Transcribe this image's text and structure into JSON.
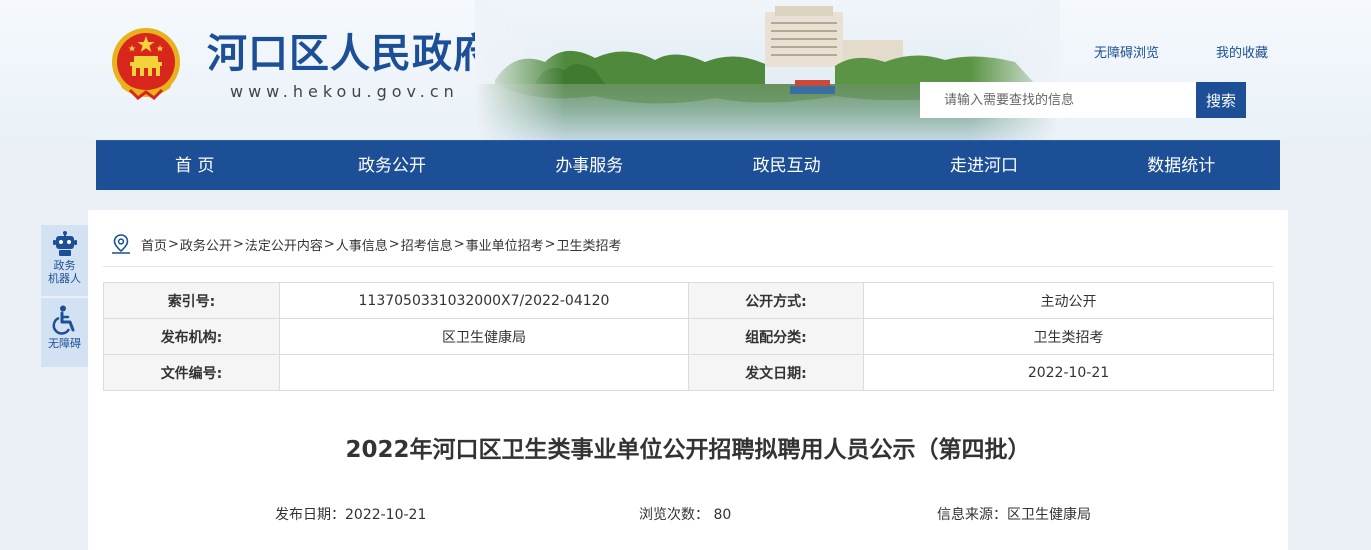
{
  "header": {
    "site_title": "河口区人民政府",
    "site_url": "www.hekou.gov.cn",
    "accessible_link": "无障碍浏览",
    "favorites_link": "我的收藏",
    "search_placeholder": "请输入需要查找的信息",
    "search_button": "搜索"
  },
  "nav": {
    "items": [
      "首 页",
      "政务公开",
      "办事服务",
      "政民互动",
      "走进河口",
      "数据统计"
    ]
  },
  "side": {
    "robot_label_1": "政务",
    "robot_label_2": "机器人",
    "accessibility_label": "无障碍"
  },
  "breadcrumb": {
    "items": [
      "首页",
      "政务公开",
      "法定公开内容",
      "人事信息",
      "招考信息",
      "事业单位招考",
      "卫生类招考"
    ],
    "separator": ">"
  },
  "meta": {
    "rows": [
      [
        {
          "k": "索引号:"
        },
        {
          "v": "1137050331032000X7/2022-04120"
        },
        {
          "k": "公开方式:"
        },
        {
          "v": "主动公开"
        }
      ],
      [
        {
          "k": "发布机构:"
        },
        {
          "v": "区卫生健康局"
        },
        {
          "k": "组配分类:"
        },
        {
          "v": "卫生类招考"
        }
      ],
      [
        {
          "k": "文件编号:"
        },
        {
          "v": ""
        },
        {
          "k": "发文日期:"
        },
        {
          "v": "2022-10-21"
        }
      ]
    ]
  },
  "article": {
    "title": "2022年河口区卫生类事业单位公开招聘拟聘用人员公示（第四批）",
    "publish_date": "发布日期：2022-10-21",
    "views": "浏览次数：  80",
    "source": "信息来源：区卫生健康局"
  },
  "colors": {
    "brand_blue": "#1c4f96",
    "page_bg": "#eaf0f6",
    "side_bg": "#d3e2f3"
  }
}
